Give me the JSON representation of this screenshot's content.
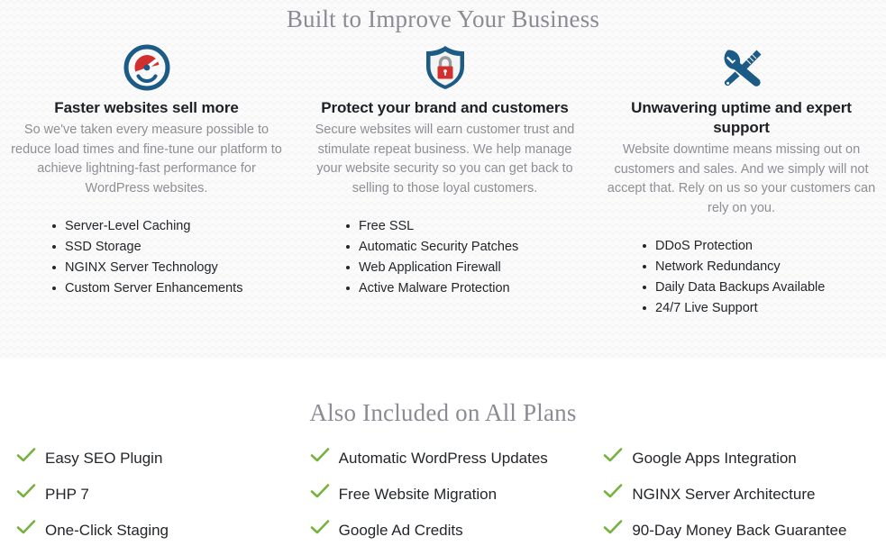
{
  "features": {
    "title": "Built to Improve Your Business",
    "columns": [
      {
        "icon": "speedometer-icon",
        "title": "Faster websites sell more",
        "description": "So we've taken every measure possible to reduce load times and fine-tune our platform to achieve lightning-fast performance for WordPress websites.",
        "items": [
          "Server-Level Caching",
          "SSD Storage",
          "NGINX Server Technology",
          "Custom Server Enhancements"
        ]
      },
      {
        "icon": "shield-lock-icon",
        "title": "Protect your brand and customers",
        "description": "Secure websites will earn customer trust and stimulate repeat business. We help manage your website security so you can get back to selling to those loyal customers.",
        "items": [
          "Free SSL",
          "Automatic Security Patches",
          "Web Application Firewall",
          "Active Malware Protection"
        ]
      },
      {
        "icon": "wrench-screwdriver-icon",
        "title": "Unwavering uptime and expert support",
        "description": "Website downtime means missing out on customers and sales. And we simply will not accept that. Rely on us so your customers can rely on you.",
        "items": [
          "DDoS Protection",
          "Network Redundancy",
          "Daily Data Backups Available",
          "24/7 Live Support"
        ]
      }
    ]
  },
  "included": {
    "title": "Also Included on All Plans",
    "columns": [
      [
        "Easy SEO Plugin",
        "PHP 7",
        "One-Click Staging"
      ],
      [
        "Automatic WordPress Updates",
        "Free Website Migration",
        "Google Ad Credits"
      ],
      [
        "Google Apps Integration",
        "NGINX Server Architecture",
        "90-Day Money Back Guarantee"
      ]
    ]
  },
  "colors": {
    "heading": "#8b8b93",
    "body_text": "#8e8e95",
    "dark_text": "#23262a",
    "icon_blue": "#1b5b86",
    "icon_red": "#d22f2f",
    "check_green": "#77b23f"
  }
}
